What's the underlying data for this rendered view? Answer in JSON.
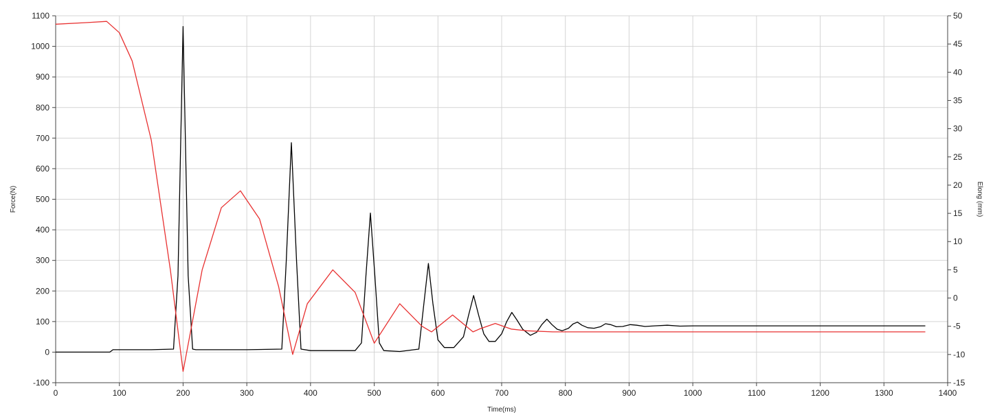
{
  "chart_data": {
    "type": "line",
    "xlabel": "Time(ms)",
    "ylabel_left": "Force(N)",
    "ylabel_right": "Elong (mm)",
    "xlim": [
      0,
      1400
    ],
    "ylim_left": [
      -100,
      1100
    ],
    "ylim_right": [
      -15,
      50
    ],
    "x_ticks": [
      0,
      100,
      200,
      300,
      400,
      500,
      600,
      700,
      800,
      900,
      1000,
      1100,
      1200,
      1300,
      1400
    ],
    "y_left_ticks": [
      -100,
      0,
      100,
      200,
      300,
      400,
      500,
      600,
      700,
      800,
      900,
      1000,
      1100
    ],
    "y_right_ticks": [
      -15,
      -10,
      -5,
      0,
      5,
      10,
      15,
      20,
      25,
      30,
      35,
      40,
      45,
      50
    ],
    "grid": true,
    "series": [
      {
        "axis": "left",
        "color": "#000000",
        "x": [
          0,
          85,
          90,
          150,
          185,
          192,
          200,
          208,
          215,
          220,
          300,
          355,
          362,
          370,
          378,
          385,
          400,
          470,
          480,
          487,
          494,
          501,
          508,
          515,
          540,
          570,
          578,
          585,
          592,
          600,
          610,
          625,
          640,
          648,
          656,
          664,
          672,
          680,
          690,
          700,
          708,
          716,
          724,
          733,
          745,
          755,
          763,
          771,
          779,
          787,
          795,
          805,
          812,
          819,
          826,
          835,
          845,
          855,
          863,
          871,
          880,
          890,
          902,
          912,
          925,
          940,
          960,
          980,
          1000,
          1100,
          1200,
          1300,
          1365
        ],
        "y": [
          0,
          0,
          8,
          8,
          10,
          250,
          1065,
          250,
          10,
          8,
          8,
          10,
          300,
          685,
          300,
          10,
          5,
          5,
          30,
          250,
          455,
          250,
          30,
          5,
          2,
          10,
          160,
          290,
          160,
          40,
          15,
          15,
          50,
          120,
          185,
          120,
          60,
          35,
          35,
          60,
          100,
          130,
          105,
          75,
          55,
          65,
          90,
          108,
          90,
          75,
          70,
          78,
          92,
          98,
          88,
          80,
          78,
          83,
          93,
          90,
          83,
          84,
          90,
          88,
          84,
          86,
          88,
          85,
          86,
          86,
          86,
          86,
          86
        ]
      },
      {
        "axis": "right",
        "color": "#e83030",
        "x": [
          0,
          50,
          80,
          100,
          120,
          150,
          180,
          200,
          230,
          260,
          290,
          320,
          350,
          372,
          395,
          435,
          470,
          500,
          540,
          575,
          590,
          623,
          655,
          665,
          690,
          715,
          740,
          780,
          820,
          900,
          1000,
          1100,
          1200,
          1300,
          1365
        ],
        "y": [
          48.5,
          48.8,
          49,
          47,
          42,
          28,
          5,
          -13,
          5,
          16,
          19,
          14,
          2,
          -10,
          -1,
          5,
          1,
          -8,
          -1,
          -5,
          -6,
          -3,
          -6,
          -5.5,
          -4.5,
          -5.5,
          -5.8,
          -6,
          -6,
          -6,
          -6,
          -6,
          -6,
          -6,
          -6
        ]
      }
    ]
  }
}
